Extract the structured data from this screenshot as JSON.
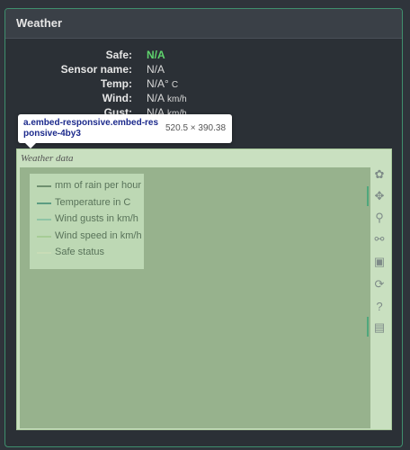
{
  "panel": {
    "title": "Weather"
  },
  "info": [
    {
      "label": "Safe:",
      "value": "N/A",
      "unit": "",
      "color": "#5fd46d"
    },
    {
      "label": "Sensor name:",
      "value": "N/A",
      "unit": ""
    },
    {
      "label": "Temp:",
      "value": "N/A°",
      "unit": "C"
    },
    {
      "label": "Wind:",
      "value": "N/A",
      "unit": "km/h"
    },
    {
      "label": "Gust:",
      "value": "N/A",
      "unit": "km/h"
    }
  ],
  "tooltip": {
    "selector": "a.embed-responsive.embed-responsive-4by3",
    "size": "520.5 × 390.38"
  },
  "chart": {
    "title": "Weather data",
    "legend": [
      {
        "label": "mm of rain per hour",
        "color": "#6f8f6f"
      },
      {
        "label": "Temperature in C",
        "color": "#5c9c82"
      },
      {
        "label": "Wind gusts in km/h",
        "color": "#8fc4a6"
      },
      {
        "label": "Wind speed in km/h",
        "color": "#a6cc96"
      },
      {
        "label": "Safe status",
        "color": "#c8dcb6"
      }
    ]
  },
  "toolbar": {
    "tools": [
      {
        "name": "plotly-logo-icon",
        "glyph": "✿"
      },
      {
        "name": "pan-icon",
        "glyph": "✥"
      },
      {
        "name": "zoom-icon",
        "glyph": "⚲"
      },
      {
        "name": "compare-hover-icon",
        "glyph": "⚯"
      },
      {
        "name": "save-icon",
        "glyph": "▣"
      },
      {
        "name": "reset-icon",
        "glyph": "⟳"
      },
      {
        "name": "help-icon",
        "glyph": "?"
      },
      {
        "name": "comment-icon",
        "glyph": "▤"
      }
    ]
  }
}
